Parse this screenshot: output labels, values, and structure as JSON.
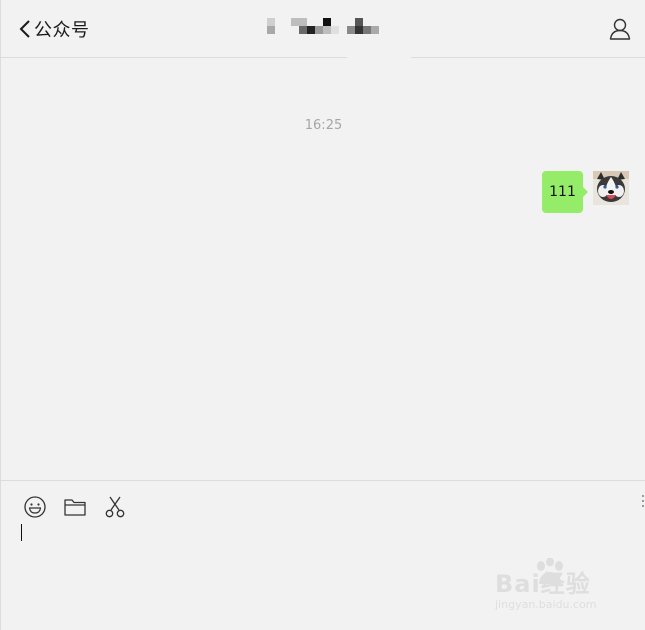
{
  "header": {
    "back_label": "公众号",
    "title": ""
  },
  "chat": {
    "timestamp": "16:25",
    "messages": [
      {
        "sender": "me",
        "text": "111"
      }
    ]
  },
  "composer": {
    "input_value": "",
    "tools": [
      "emoji-icon",
      "folder-icon",
      "scissors-icon"
    ]
  },
  "watermark": {
    "main": "Bai经验",
    "sub": "jingyan.baidu.com"
  },
  "colors": {
    "background": "#f2f2f2",
    "bubble": "#95ec69",
    "divider": "#dcdcdc",
    "timestamp": "#a6a6a6"
  }
}
